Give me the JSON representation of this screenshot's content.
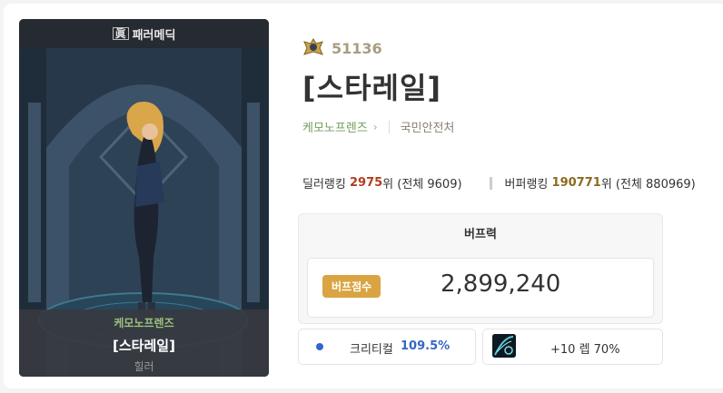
{
  "character": {
    "tag": "眞",
    "class_title": "패러메딕",
    "guild": "케모노프렌즈",
    "name": "[스타레일]",
    "role": "힐러"
  },
  "fame": {
    "icon": "fame-emblem-icon",
    "value": "51136"
  },
  "title": "[스타레일]",
  "guild_row": {
    "guild": "케모노프렌즈",
    "chevron": "›",
    "adventure": "국민안전처"
  },
  "ranks": {
    "dealer_label": "딜러랭킹",
    "dealer_rank": "2975",
    "dealer_suffix": "위 (전체 9609)",
    "buffer_label": "버퍼랭킹",
    "buffer_rank": "190771",
    "buffer_suffix": "위 (전체 880969)"
  },
  "buff": {
    "title": "버프력",
    "badge": "버프점수",
    "score": "2,899,240"
  },
  "stats": {
    "crit_label": "크리티컬",
    "crit_value": "109.5%",
    "gear_text": "+10 렙 70%"
  },
  "colors": {
    "dealer": "#b23d1e",
    "buffer": "#8a6a1d",
    "badge": "#d9a441",
    "crit": "#3566c6",
    "guild": "#6f9d5c"
  }
}
